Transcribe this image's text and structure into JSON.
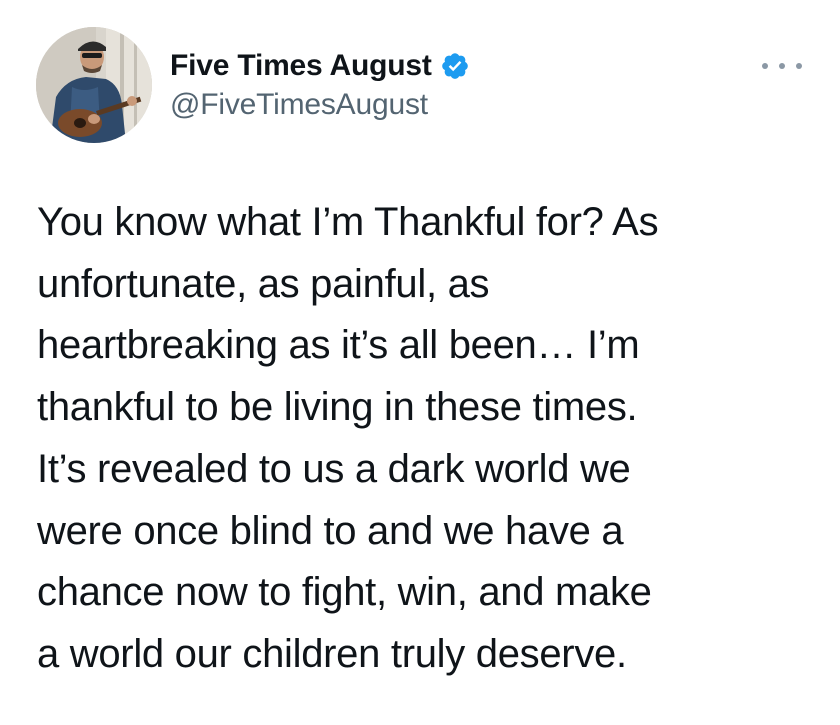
{
  "author": {
    "display_name": "Five Times August",
    "handle": "@FiveTimesAugust",
    "verified": true,
    "avatar_icon": "profile-photo-man-with-guitar"
  },
  "menu": {
    "icon": "more-options-icon"
  },
  "tweet": {
    "lines": [
      "You know what I’m Thankful for? As",
      "unfortunate, as painful, as",
      "heartbreaking as it’s all been… I’m",
      "thankful to be living in these times.",
      "It’s revealed to us a dark world we",
      "were once blind to and we have a",
      "chance now to fight, win, and make",
      "a world our children truly deserve."
    ]
  },
  "colors": {
    "verified_badge": "#1d9bf0",
    "handle_text": "#536471",
    "body_text": "#0f1419"
  }
}
